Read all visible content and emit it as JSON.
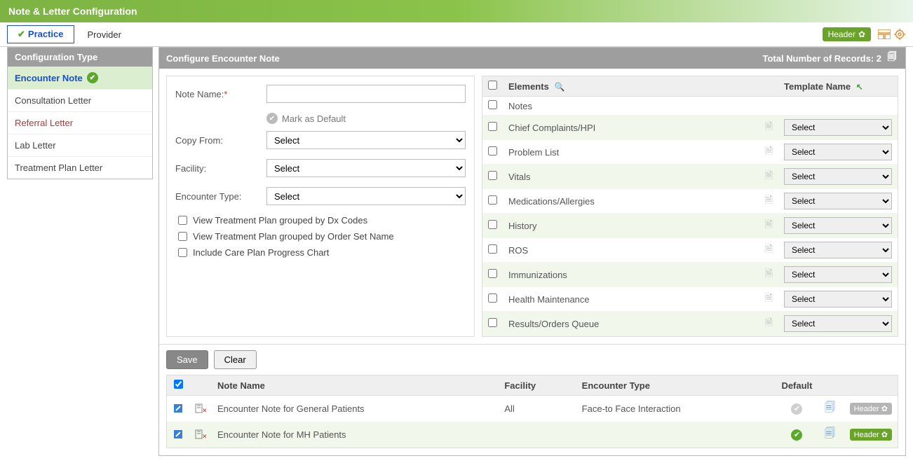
{
  "header": {
    "title": "Note & Letter Configuration"
  },
  "tabs": {
    "practice": "Practice",
    "provider": "Provider"
  },
  "toolbar": {
    "header_btn": "Header"
  },
  "sidebar": {
    "title": "Configuration Type",
    "items": [
      {
        "label": "Encounter Note",
        "active": true,
        "check": true
      },
      {
        "label": "Consultation Letter"
      },
      {
        "label": "Referral Letter",
        "warn": true
      },
      {
        "label": "Lab Letter"
      },
      {
        "label": "Treatment Plan Letter"
      }
    ]
  },
  "main": {
    "title": "Configure Encounter Note",
    "records_label": "Total Number of Records:",
    "records_count": "2"
  },
  "form": {
    "note_name_label": "Note Name:",
    "mark_default": "Mark as Default",
    "copy_from_label": "Copy From:",
    "facility_label": "Facility:",
    "encounter_type_label": "Encounter Type:",
    "select_placeholder": "Select",
    "chk1": "View Treatment Plan grouped by Dx Codes",
    "chk2": "View Treatment Plan grouped by Order Set Name",
    "chk3": "Include Care Plan Progress Chart"
  },
  "elements": {
    "col_elements": "Elements",
    "col_template": "Template Name",
    "select_opt": "Select",
    "rows": [
      {
        "name": "Notes",
        "alt": false,
        "icon": false,
        "tpl": false
      },
      {
        "name": "Chief Complaints/HPI",
        "alt": true,
        "icon": true,
        "tpl": true
      },
      {
        "name": "Problem List",
        "alt": false,
        "icon": true,
        "tpl": true
      },
      {
        "name": "Vitals",
        "alt": true,
        "icon": true,
        "tpl": true
      },
      {
        "name": "Medications/Allergies",
        "alt": false,
        "icon": true,
        "tpl": true
      },
      {
        "name": "History",
        "alt": true,
        "icon": true,
        "tpl": true
      },
      {
        "name": "ROS",
        "alt": false,
        "icon": true,
        "tpl": true
      },
      {
        "name": "Immunizations",
        "alt": true,
        "icon": true,
        "tpl": true
      },
      {
        "name": "Health Maintenance",
        "alt": false,
        "icon": true,
        "tpl": true
      },
      {
        "name": "Results/Orders Queue",
        "alt": true,
        "icon": true,
        "tpl": true
      }
    ]
  },
  "buttons": {
    "save": "Save",
    "clear": "Clear"
  },
  "notes": {
    "col_name": "Note Name",
    "col_facility": "Facility",
    "col_enc": "Encounter Type",
    "col_default": "Default",
    "header_btn": "Header",
    "rows": [
      {
        "name": "Encounter Note for General Patients",
        "facility": "All",
        "enc": "Face-to Face Interaction",
        "default_on": false,
        "alt": false,
        "pill_green": false
      },
      {
        "name": "Encounter Note for MH Patients",
        "facility": "",
        "enc": "",
        "default_on": true,
        "alt": true,
        "pill_green": true
      }
    ]
  }
}
